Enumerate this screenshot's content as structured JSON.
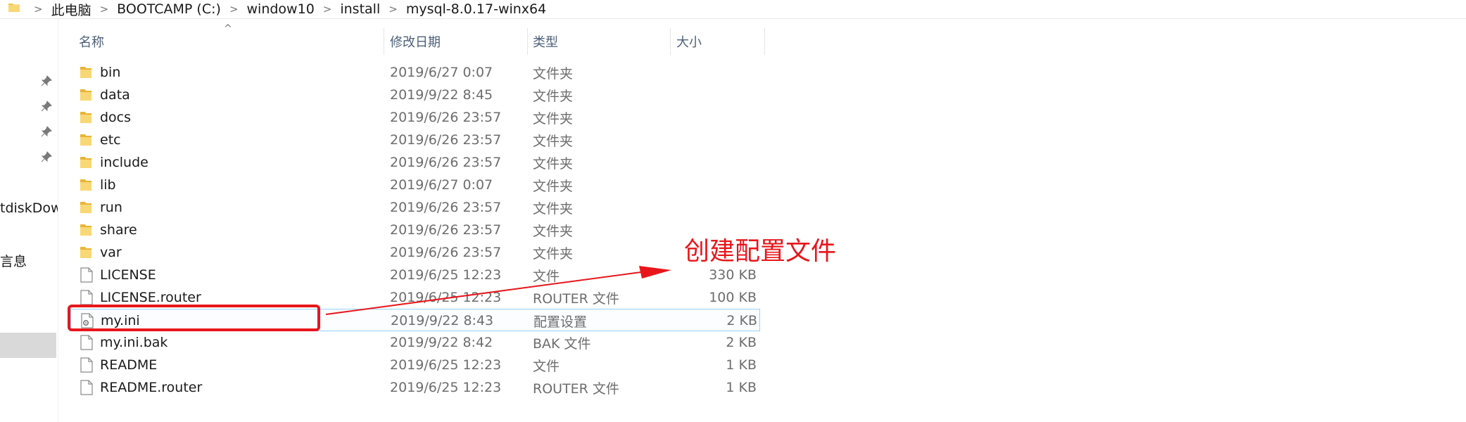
{
  "address_bar": {
    "crumbs": [
      "此电脑",
      "BOOTCAMP (C:)",
      "window10",
      "install",
      "mysql-8.0.17-winx64"
    ],
    "separator": ">"
  },
  "nav_pane": {
    "partial_items": [
      "tdiskDown",
      "言息"
    ]
  },
  "columns": {
    "name": "名称",
    "date": "修改日期",
    "type": "类型",
    "size": "大小"
  },
  "files": [
    {
      "name": "bin",
      "date": "2019/6/27 0:07",
      "type": "文件夹",
      "size": "",
      "icon": "folder-icon"
    },
    {
      "name": "data",
      "date": "2019/9/22 8:45",
      "type": "文件夹",
      "size": "",
      "icon": "folder-icon"
    },
    {
      "name": "docs",
      "date": "2019/6/26 23:57",
      "type": "文件夹",
      "size": "",
      "icon": "folder-icon"
    },
    {
      "name": "etc",
      "date": "2019/6/26 23:57",
      "type": "文件夹",
      "size": "",
      "icon": "folder-icon"
    },
    {
      "name": "include",
      "date": "2019/6/26 23:57",
      "type": "文件夹",
      "size": "",
      "icon": "folder-icon"
    },
    {
      "name": "lib",
      "date": "2019/6/27 0:07",
      "type": "文件夹",
      "size": "",
      "icon": "folder-icon"
    },
    {
      "name": "run",
      "date": "2019/6/26 23:57",
      "type": "文件夹",
      "size": "",
      "icon": "folder-icon"
    },
    {
      "name": "share",
      "date": "2019/6/26 23:57",
      "type": "文件夹",
      "size": "",
      "icon": "folder-icon"
    },
    {
      "name": "var",
      "date": "2019/6/26 23:57",
      "type": "文件夹",
      "size": "",
      "icon": "folder-icon"
    },
    {
      "name": "LICENSE",
      "date": "2019/6/25 12:23",
      "type": "文件",
      "size": "330 KB",
      "icon": "file-icon"
    },
    {
      "name": "LICENSE.router",
      "date": "2019/6/25 12:23",
      "type": "ROUTER 文件",
      "size": "100 KB",
      "icon": "file-icon"
    },
    {
      "name": "my.ini",
      "date": "2019/9/22 8:43",
      "type": "配置设置",
      "size": "2 KB",
      "icon": "config-file-icon"
    },
    {
      "name": "my.ini.bak",
      "date": "2019/9/22 8:42",
      "type": "BAK 文件",
      "size": "2 KB",
      "icon": "file-icon"
    },
    {
      "name": "README",
      "date": "2019/6/25 12:23",
      "type": "文件",
      "size": "1 KB",
      "icon": "file-icon"
    },
    {
      "name": "README.router",
      "date": "2019/6/25 12:23",
      "type": "ROUTER 文件",
      "size": "1 KB",
      "icon": "file-icon"
    }
  ],
  "selected_file": "my.ini",
  "annotation": {
    "text": "创建配置文件",
    "color": "#e8161b"
  },
  "colors": {
    "folder": "#f3c74f",
    "selection_border": "#99d1ff",
    "header_text": "#4c607a",
    "annotation": "#e8161b"
  }
}
